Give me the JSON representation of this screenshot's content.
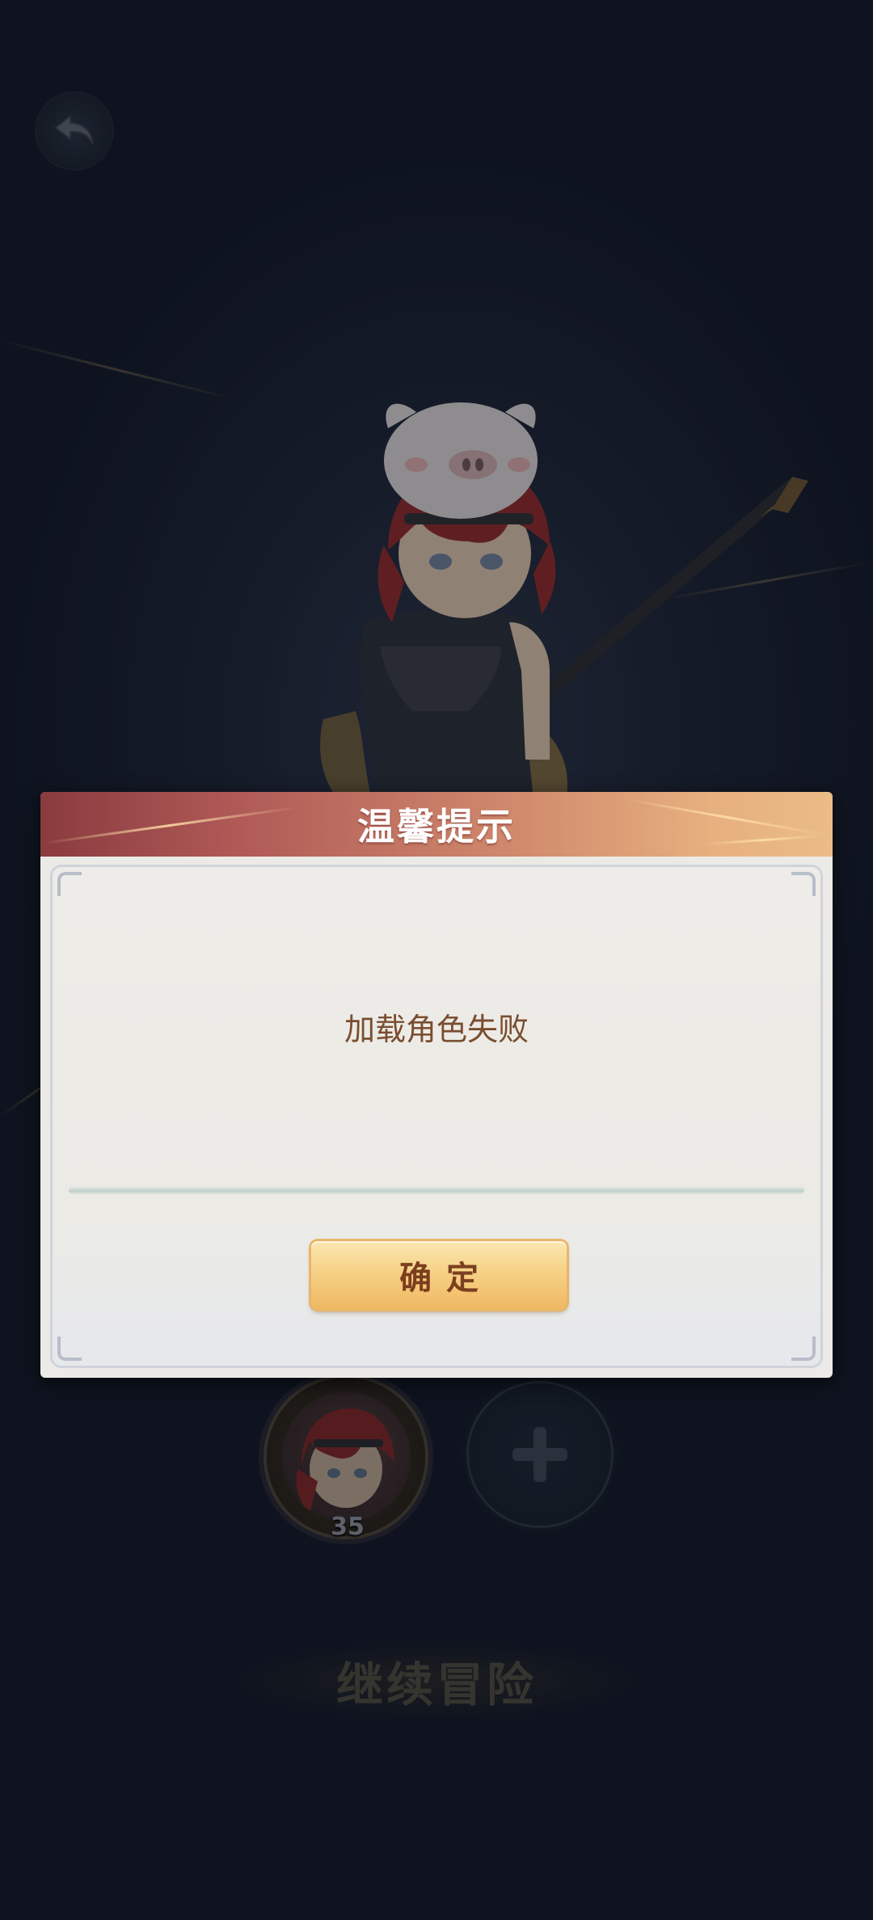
{
  "screen": {
    "background_color": "#101722",
    "overlay_color": "rgba(8,12,20,0.35)"
  },
  "topbar": {
    "back_icon": "undo-arrow-icon"
  },
  "team": {
    "hero_level": "35",
    "add_icon": "plus-icon"
  },
  "continue_button": {
    "label": "继续冒险"
  },
  "dialog": {
    "title": "温馨提示",
    "message": "加载角色失败",
    "confirm_label": "确定",
    "header_gradient": [
      "#8a3b3f",
      "#eabc86"
    ],
    "confirm_text_color": "#7b3f1f"
  }
}
